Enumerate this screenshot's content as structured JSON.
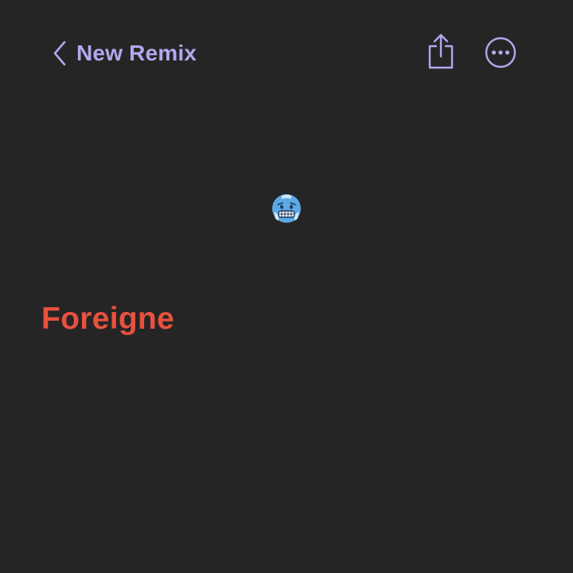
{
  "header": {
    "back_label": "New Remix",
    "accent_color": "#b2a8ee",
    "icons": [
      "chevron-left-icon",
      "share-icon",
      "more-icon"
    ]
  },
  "content": {
    "emoji": "cold-face",
    "title": "Foreigne",
    "title_color": "#e8513f"
  },
  "colors": {
    "background": "#252525"
  }
}
